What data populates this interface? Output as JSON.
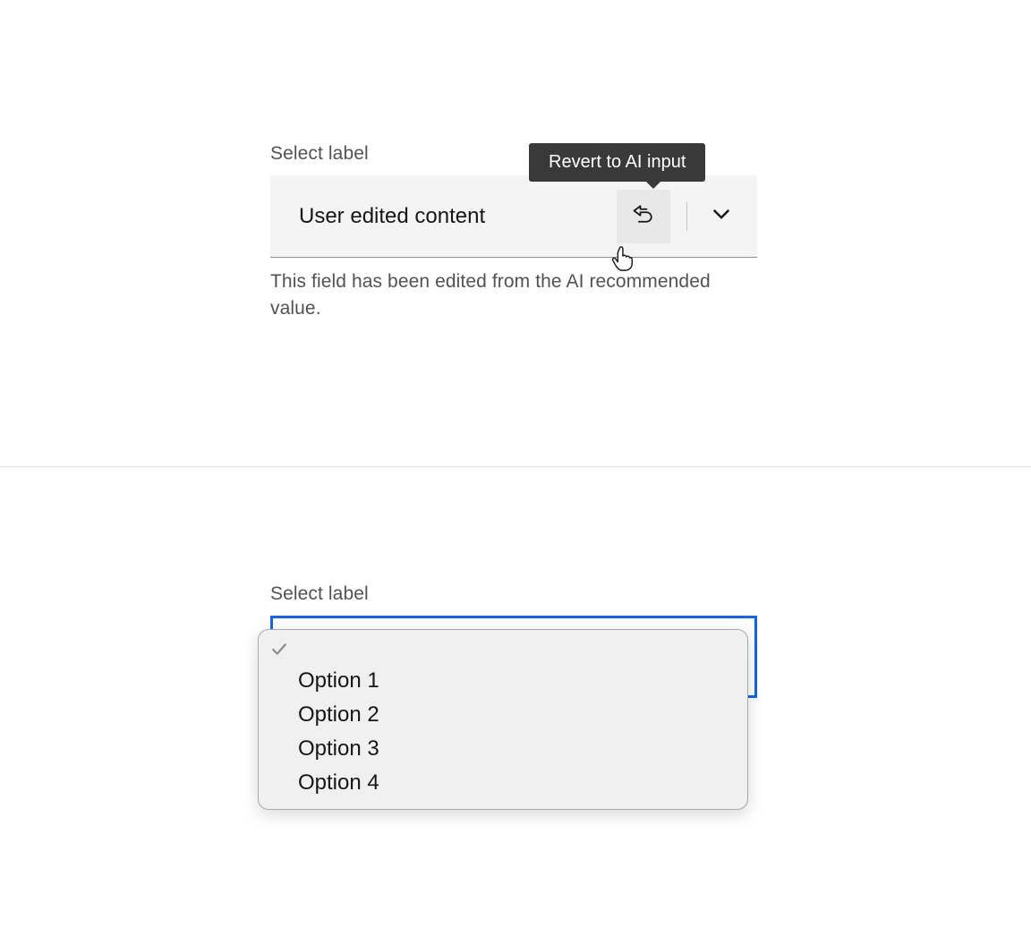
{
  "top": {
    "label": "Select label",
    "value": "User edited content",
    "tooltip": "Revert to AI input",
    "helper": "This field has been edited from the AI recommended value."
  },
  "bottom": {
    "label": "Select label",
    "options": {
      "0": "",
      "1": "Option 1",
      "2": "Option 2",
      "3": "Option 3",
      "4": "Option 4"
    }
  }
}
